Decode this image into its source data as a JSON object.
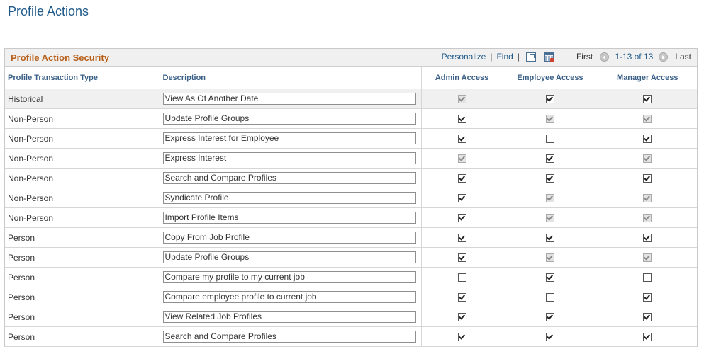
{
  "page": {
    "title": "Profile Actions"
  },
  "grid": {
    "title": "Profile Action Security",
    "nav": {
      "personalize": "Personalize",
      "separator": "|",
      "find": "Find",
      "first": "First",
      "range": "1-13 of 13",
      "last": "Last"
    },
    "columns": {
      "type": "Profile Transaction Type",
      "description": "Description",
      "admin": "Admin Access",
      "employee": "Employee Access",
      "manager": "Manager Access"
    },
    "rows": [
      {
        "type": "Historical",
        "description": "View As Of Another Date",
        "admin": {
          "checked": true,
          "disabled": true
        },
        "employee": {
          "checked": true,
          "disabled": false
        },
        "manager": {
          "checked": true,
          "disabled": false
        }
      },
      {
        "type": "Non-Person",
        "description": "Update Profile Groups",
        "admin": {
          "checked": true,
          "disabled": false
        },
        "employee": {
          "checked": true,
          "disabled": true
        },
        "manager": {
          "checked": true,
          "disabled": true
        }
      },
      {
        "type": "Non-Person",
        "description": "Express Interest for Employee",
        "admin": {
          "checked": true,
          "disabled": false
        },
        "employee": {
          "checked": false,
          "disabled": false
        },
        "manager": {
          "checked": true,
          "disabled": false
        }
      },
      {
        "type": "Non-Person",
        "description": "Express Interest",
        "admin": {
          "checked": true,
          "disabled": true
        },
        "employee": {
          "checked": true,
          "disabled": false
        },
        "manager": {
          "checked": true,
          "disabled": true
        }
      },
      {
        "type": "Non-Person",
        "description": "Search and Compare Profiles",
        "admin": {
          "checked": true,
          "disabled": false
        },
        "employee": {
          "checked": true,
          "disabled": false
        },
        "manager": {
          "checked": true,
          "disabled": false
        }
      },
      {
        "type": "Non-Person",
        "description": "Syndicate Profile",
        "admin": {
          "checked": true,
          "disabled": false
        },
        "employee": {
          "checked": true,
          "disabled": true
        },
        "manager": {
          "checked": true,
          "disabled": true
        }
      },
      {
        "type": "Non-Person",
        "description": "Import Profile Items",
        "admin": {
          "checked": true,
          "disabled": false
        },
        "employee": {
          "checked": true,
          "disabled": true
        },
        "manager": {
          "checked": true,
          "disabled": true
        }
      },
      {
        "type": "Person",
        "description": "Copy From Job Profile",
        "admin": {
          "checked": true,
          "disabled": false
        },
        "employee": {
          "checked": true,
          "disabled": false
        },
        "manager": {
          "checked": true,
          "disabled": false
        }
      },
      {
        "type": "Person",
        "description": "Update Profile Groups",
        "admin": {
          "checked": true,
          "disabled": false
        },
        "employee": {
          "checked": true,
          "disabled": true
        },
        "manager": {
          "checked": true,
          "disabled": true
        }
      },
      {
        "type": "Person",
        "description": "Compare my profile to my current job",
        "admin": {
          "checked": false,
          "disabled": false
        },
        "employee": {
          "checked": true,
          "disabled": false
        },
        "manager": {
          "checked": false,
          "disabled": false
        }
      },
      {
        "type": "Person",
        "description": "Compare employee profile to current job",
        "admin": {
          "checked": true,
          "disabled": false
        },
        "employee": {
          "checked": false,
          "disabled": false
        },
        "manager": {
          "checked": true,
          "disabled": false
        }
      },
      {
        "type": "Person",
        "description": "View Related Job Profiles",
        "admin": {
          "checked": true,
          "disabled": false
        },
        "employee": {
          "checked": true,
          "disabled": false
        },
        "manager": {
          "checked": true,
          "disabled": false
        }
      },
      {
        "type": "Person",
        "description": "Search and Compare Profiles",
        "admin": {
          "checked": true,
          "disabled": false
        },
        "employee": {
          "checked": true,
          "disabled": false
        },
        "manager": {
          "checked": true,
          "disabled": false
        }
      }
    ]
  },
  "icons": {
    "zoom": "new-window-icon",
    "download": "download-grid-icon",
    "first": "chevron-left-icon",
    "last": "chevron-right-icon"
  },
  "colors": {
    "title": "#1f5a8a",
    "grid_title": "#b8601a",
    "header_text": "#3a5f86",
    "shaded_row": "#f0f0f0"
  }
}
